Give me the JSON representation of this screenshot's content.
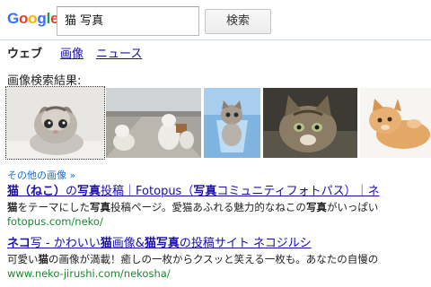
{
  "logo": {
    "text": "Google",
    "letters": [
      "G",
      "o",
      "o",
      "g",
      "l",
      "e"
    ],
    "colors": [
      "#3b6ef0",
      "#e0412f",
      "#f4b400",
      "#3b6ef0",
      "#1a9f47",
      "#e0412f"
    ]
  },
  "search": {
    "value": "猫 写真",
    "button_label": "検索"
  },
  "nav": {
    "active": "ウェブ",
    "items": [
      "画像",
      "ニュース"
    ]
  },
  "images": {
    "heading": "画像検索結果:",
    "more_label": "その他の画像 »"
  },
  "results": [
    {
      "title_parts": [
        "猫（ねこ）",
        "の",
        "写真",
        "投稿｜Fotopus（",
        "写真",
        "コミュニティフォトパス）｜ネ"
      ],
      "snippet_parts": [
        "猫",
        "をテーマにした",
        "写真",
        "投稿ページ。愛猫あふれる魅力的なねこの",
        "写真",
        "がいっぱい"
      ],
      "url": "fotopus.com/neko/"
    },
    {
      "title_parts": [
        "ネコ",
        "写 - かわいい",
        "猫",
        "画像&",
        "猫写真",
        "の投稿サイト ネコジルシ"
      ],
      "snippet_parts": [
        "可愛い",
        "猫",
        "の画像が満載！癒しの一枚からクスッと笑える一枚も。あなたの自慢の"
      ],
      "url": "www.neko-jirushi.com/nekosha/"
    }
  ],
  "colors": {
    "link": "#1a0dab",
    "url": "#1a8a2e",
    "more_link": "#1a6fd0",
    "nav_border": "#c9d7f1"
  }
}
